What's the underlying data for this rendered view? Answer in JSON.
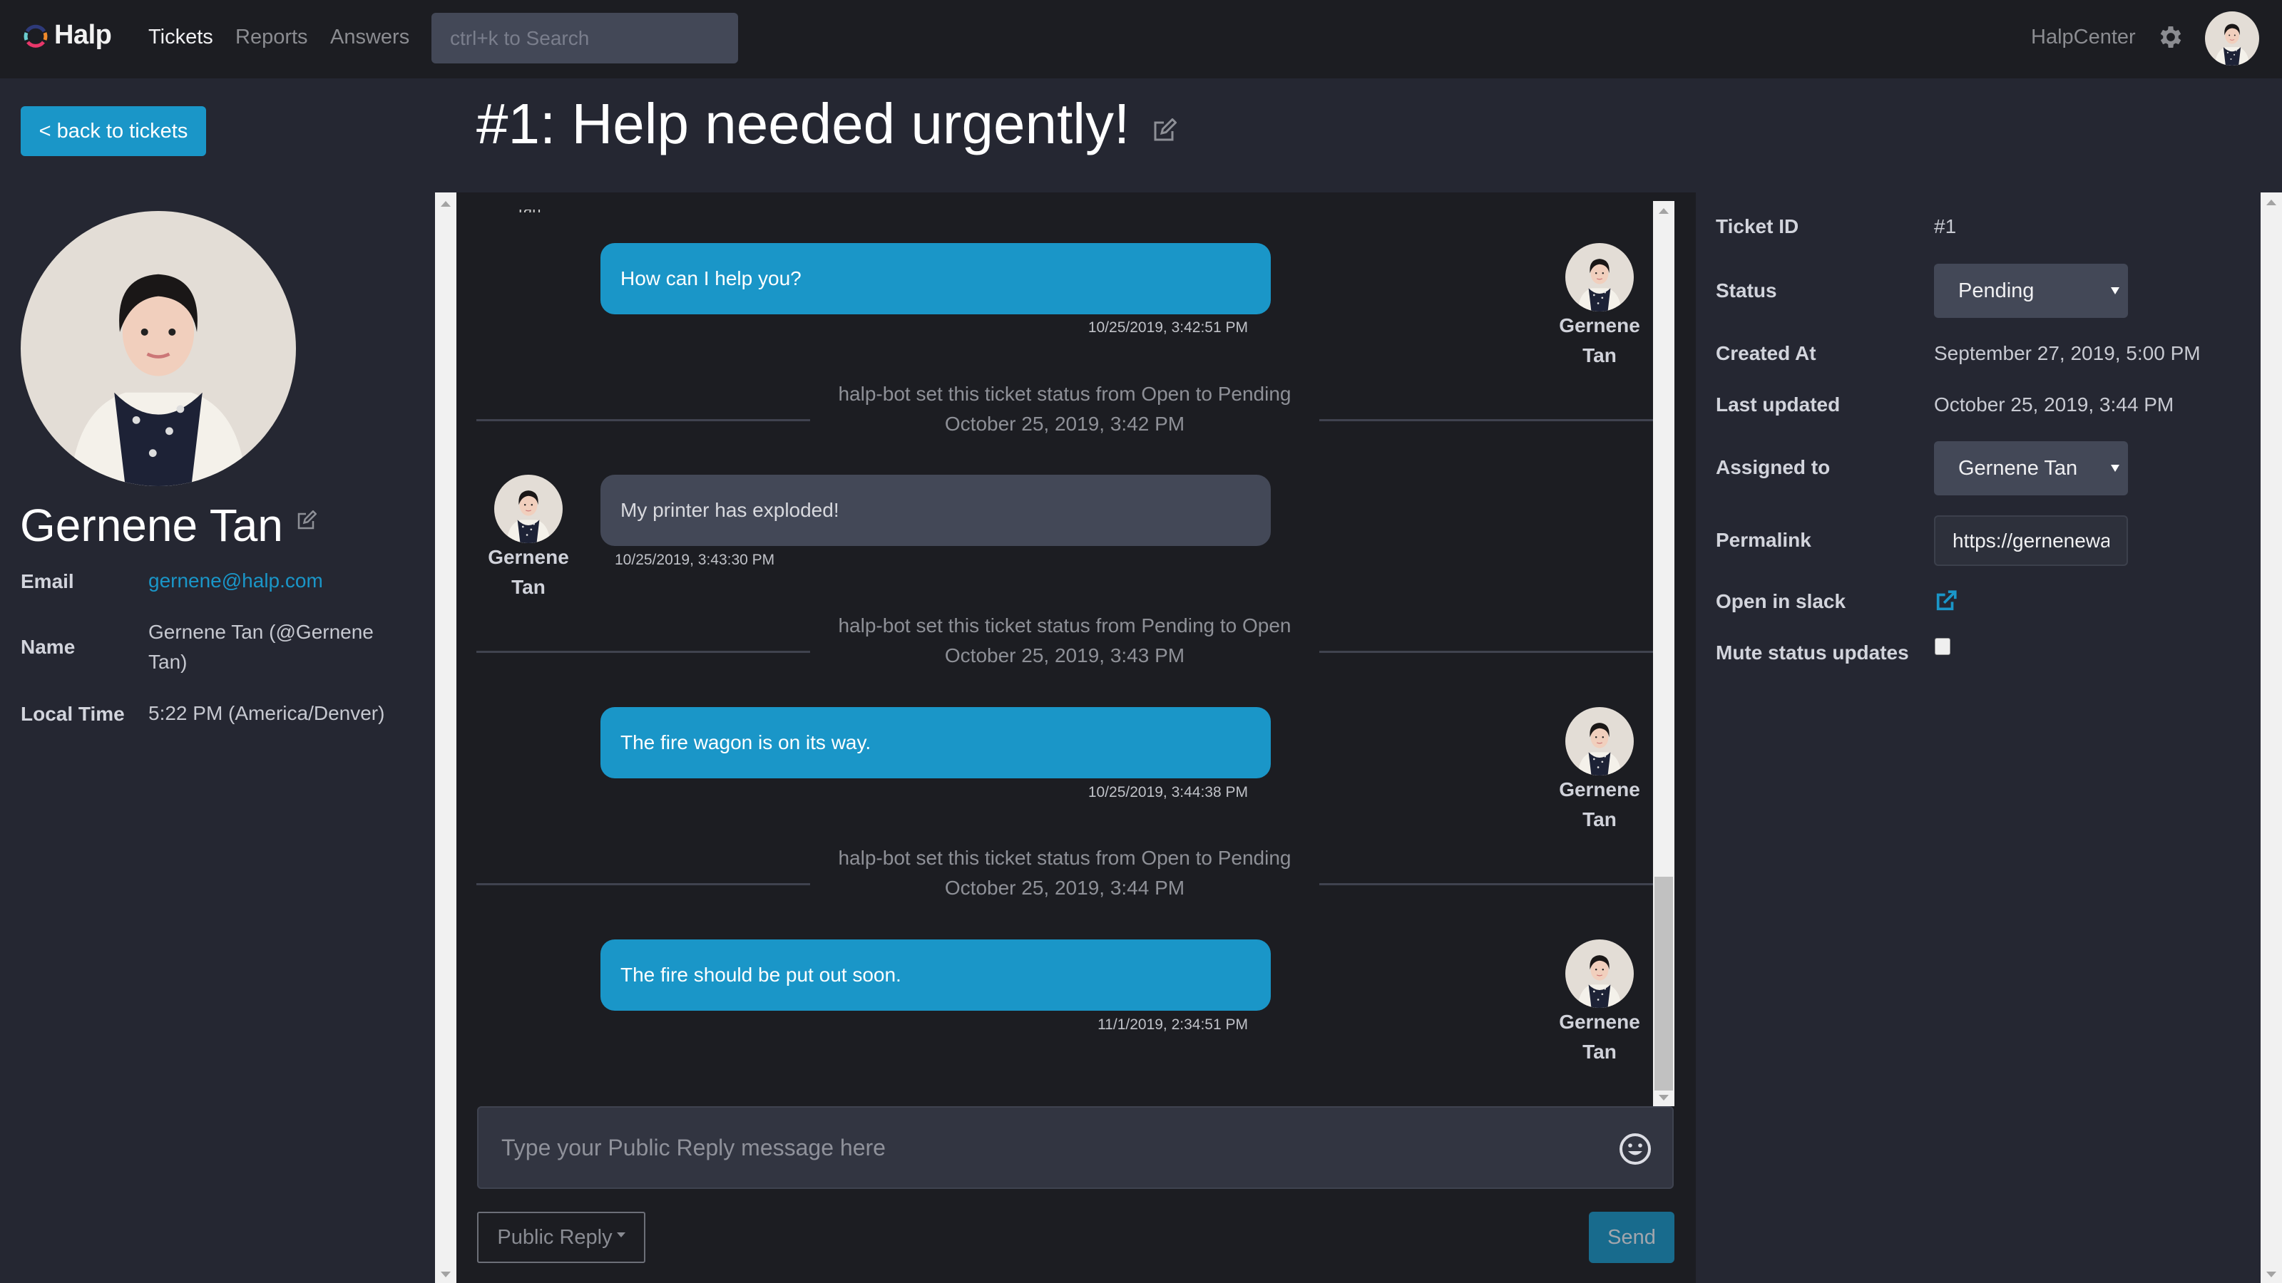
{
  "navbar": {
    "brand": "Halp",
    "links": [
      {
        "label": "Tickets",
        "active": true
      },
      {
        "label": "Reports",
        "active": false
      },
      {
        "label": "Answers",
        "active": false
      }
    ],
    "search_placeholder": "ctrl+k to Search",
    "workspace": "HalpCenter",
    "settings_icon": "gear-icon",
    "user_avatar": "avatar"
  },
  "left": {
    "back_label": "< back to tickets",
    "name": "Gernene Tan",
    "fields": [
      {
        "label": "Email",
        "value": "gernene@halp.com",
        "is_link": true
      },
      {
        "label": "Name",
        "value": "Gernene Tan (@Gernene Tan)"
      },
      {
        "label": "Local Time",
        "value": "5:22 PM (America/Denver)"
      }
    ]
  },
  "ticket": {
    "title": "#1: Help needed urgently!"
  },
  "conversation": {
    "items": [
      {
        "type": "message",
        "side": "agent",
        "text": "How can I help you?",
        "time": "10/25/2019, 3:42:51 PM",
        "author_first": "Gernene",
        "author_last": "Tan"
      },
      {
        "type": "status",
        "text": "halp-bot set this ticket status from Open to Pending",
        "date": "October 25, 2019, 3:42 PM"
      },
      {
        "type": "message",
        "side": "customer",
        "text": "My printer has exploded!",
        "time": "10/25/2019, 3:43:30 PM",
        "author_first": "Gernene",
        "author_last": "Tan"
      },
      {
        "type": "status",
        "text": "halp-bot set this ticket status from Pending to Open",
        "date": "October 25, 2019, 3:43 PM"
      },
      {
        "type": "message",
        "side": "agent",
        "text": "The fire wagon is on its way.",
        "time": "10/25/2019, 3:44:38 PM",
        "author_first": "Gernene",
        "author_last": "Tan"
      },
      {
        "type": "status",
        "text": "halp-bot set this ticket status from Open to Pending",
        "date": "October 25, 2019, 3:44 PM"
      },
      {
        "type": "message",
        "side": "agent",
        "text": "The fire should be put out soon.",
        "time": "11/1/2019, 2:34:51 PM",
        "author_first": "Gernene",
        "author_last": "Tan"
      }
    ],
    "scroll_position_fraction": 1.0
  },
  "composer": {
    "placeholder": "Type your Public Reply message here",
    "reply_type": "Public Reply",
    "send_label": "Send"
  },
  "meta": {
    "ticket_id_label": "Ticket ID",
    "ticket_id": "#1",
    "status_label": "Status",
    "status": "Pending",
    "created_label": "Created At",
    "created": "September 27, 2019, 5:00 PM",
    "updated_label": "Last updated",
    "updated": "October 25, 2019, 3:44 PM",
    "assigned_label": "Assigned to",
    "assigned": "Gernene Tan",
    "permalink_label": "Permalink",
    "permalink": "https://gernenewalrus.ngrok.io",
    "slack_label": "Open in slack",
    "mute_label": "Mute status updates",
    "mute_checked": false
  },
  "colors": {
    "accent": "#1a96c8",
    "navbar_bg": "#1c1d22",
    "page_bg": "#252732",
    "chat_bg": "#1c1d22",
    "customer_bubble": "#434857",
    "send_button": "#186b8d"
  }
}
